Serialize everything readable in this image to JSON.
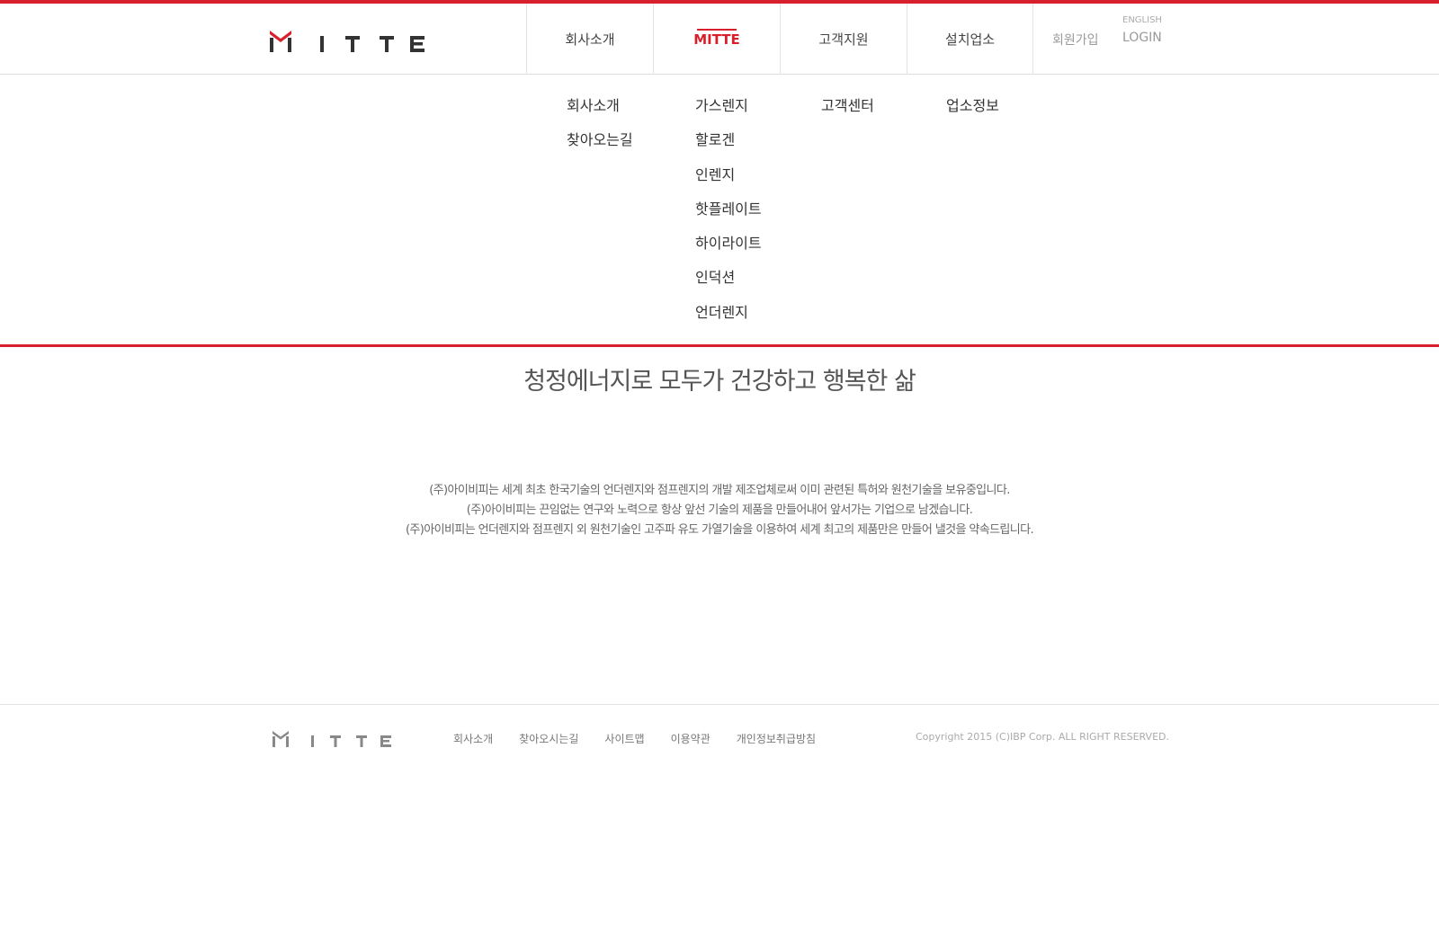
{
  "colors": {
    "accent": "#d8202c",
    "logo_dark": "#333333"
  },
  "brand": {
    "logo_text": "MITTE"
  },
  "nav": {
    "items": [
      {
        "label": "회사소개"
      },
      {
        "label": "MITTE"
      },
      {
        "label": "고객지원"
      },
      {
        "label": "설치업소"
      }
    ],
    "active": "MITTE"
  },
  "util": {
    "join": "회원가입",
    "english": "ENGLISH",
    "login": "LOGIN"
  },
  "submenu": {
    "company": [
      "회사소개",
      "찾아오는길"
    ],
    "mitte": [
      "가스렌지",
      "할로겐",
      "인렌지",
      "핫플레이트",
      "하이라이트",
      "인덕션",
      "언더렌지"
    ],
    "support": [
      "고객센터"
    ],
    "install": [
      "업소정보"
    ]
  },
  "main": {
    "slogan": "청정에너지로 모두가 건강하고 행복한 삶",
    "description": [
      "(주)아이비피는 세계 최초 한국기술의 언더렌지와 점프렌지의 개발 제조업체로써 이미 관련된 특허와 원천기술을 보유중입니다.",
      "(주)아이비피는 끈임없는 연구와 노력으로 항상 앞선 기술의 제품을 만들어내어 앞서가는 기업으로 남겠습니다.",
      "(주)아이비피는 언더렌지와 점프렌지 외 원천기술인 고주파 유도 가열기술을 이용하여 세계 최고의 제품만은 만들어 낼것을 약속드립니다."
    ]
  },
  "footer": {
    "links": [
      "회사소개",
      "찾아오시는길",
      "사이트맵",
      "이용약관",
      "개인정보취급방침"
    ],
    "copyright": "Copyright 2015 (C)IBP Corp. ALL RIGHT RESERVED."
  }
}
